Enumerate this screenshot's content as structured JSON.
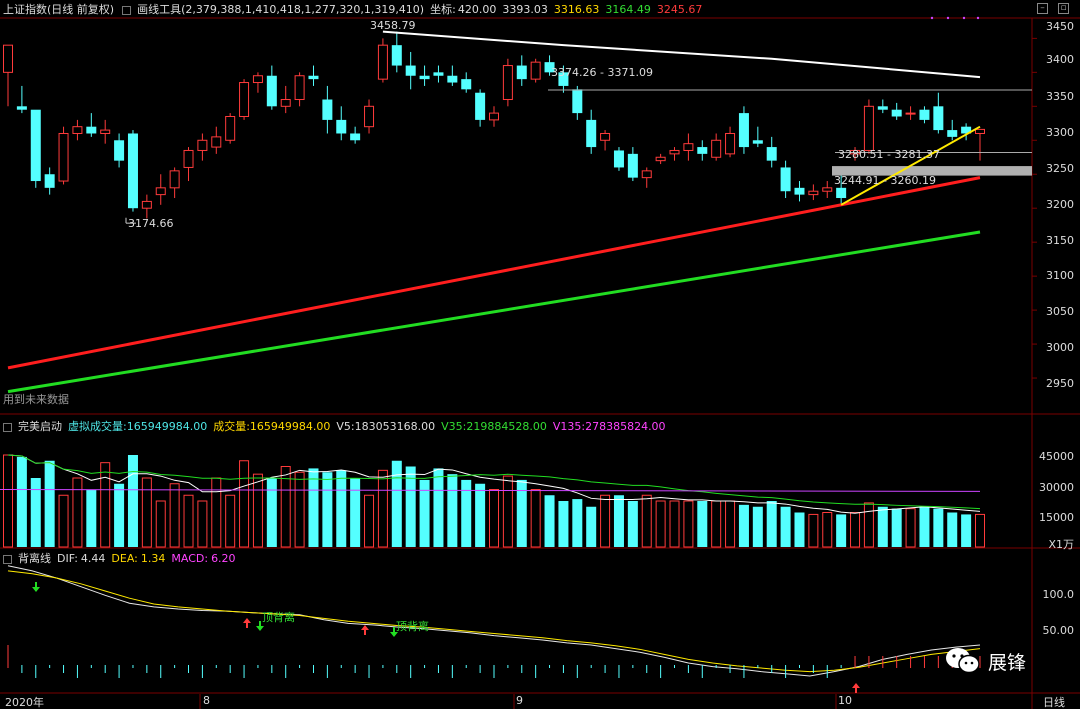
{
  "header": {
    "index_name": "上证指数(日线 前复权)",
    "tool_label": "画线工具",
    "tool_values": "(2,379,388,1,410,418,1,277,320,1,319,410)",
    "coord_label": "坐标:",
    "coord_value": "420.00",
    "open": "3393.03",
    "high": "3316.63",
    "low": "3164.49",
    "close": "3245.67"
  },
  "price_axis": [
    "3450",
    "3400",
    "3350",
    "3300",
    "3250",
    "3200",
    "3150",
    "3100",
    "3050",
    "3000",
    "2950"
  ],
  "annotations": {
    "low_point": "3174.66",
    "high_point": "3458.79",
    "range1": "3374.26 - 3371.09",
    "range2": "3280.51 - 3281.37",
    "range3": "3244.91 - 3260.19",
    "future_label": "用到未来数据"
  },
  "volume_panel": {
    "name": "完美启动",
    "virtual_label": "虚拟成交量:",
    "virtual_value": "165949984.00",
    "vol_label": "成交量:",
    "vol_value": "165949984.00",
    "v5_label": "V5:",
    "v5_value": "183053168.00",
    "v35_label": "V35:",
    "v35_value": "219884528.00",
    "v135_label": "V135:",
    "v135_value": "278385824.00",
    "axis": [
      "45000",
      "30000",
      "15000"
    ],
    "unit": "X1万"
  },
  "macd_panel": {
    "name": "背离线",
    "dif_label": "DIF:",
    "dif_value": "4.44",
    "dea_label": "DEA:",
    "dea_value": "1.34",
    "macd_label": "MACD:",
    "macd_value": "6.20",
    "axis": [
      "100.0",
      "50.00"
    ],
    "signal1": "顶背离",
    "signal2": "顶背离"
  },
  "time_axis": {
    "year": "2020年",
    "m8": "8",
    "m9": "9",
    "m10": "10",
    "period": "日线"
  },
  "watermark": {
    "text": "展锋"
  },
  "chart_data": [
    {
      "type": "candlestick",
      "title": "上证指数(日线 前复权)",
      "ylim": [
        2900,
        3480
      ],
      "candles": [
        [
          3400,
          3440,
          3350,
          3440
        ],
        [
          3350,
          3380,
          3340,
          3345
        ],
        [
          3345,
          3330,
          3230,
          3240
        ],
        [
          3250,
          3260,
          3220,
          3230
        ],
        [
          3240,
          3320,
          3235,
          3310
        ],
        [
          3310,
          3330,
          3300,
          3320
        ],
        [
          3320,
          3340,
          3305,
          3310
        ],
        [
          3310,
          3330,
          3295,
          3315
        ],
        [
          3300,
          3310,
          3260,
          3270
        ],
        [
          3310,
          3315,
          3195,
          3200
        ],
        [
          3200,
          3220,
          3185,
          3210
        ],
        [
          3220,
          3250,
          3205,
          3230
        ],
        [
          3230,
          3260,
          3215,
          3255
        ],
        [
          3260,
          3290,
          3240,
          3285
        ],
        [
          3285,
          3310,
          3270,
          3300
        ],
        [
          3290,
          3320,
          3280,
          3305
        ],
        [
          3300,
          3340,
          3295,
          3335
        ],
        [
          3335,
          3390,
          3330,
          3385
        ],
        [
          3385,
          3400,
          3370,
          3395
        ],
        [
          3395,
          3410,
          3345,
          3350
        ],
        [
          3350,
          3380,
          3340,
          3360
        ],
        [
          3360,
          3400,
          3350,
          3395
        ],
        [
          3395,
          3410,
          3380,
          3390
        ],
        [
          3360,
          3380,
          3310,
          3330
        ],
        [
          3330,
          3350,
          3300,
          3310
        ],
        [
          3310,
          3320,
          3295,
          3300
        ],
        [
          3320,
          3360,
          3310,
          3350
        ],
        [
          3390,
          3450,
          3385,
          3440
        ],
        [
          3440,
          3460,
          3400,
          3410
        ],
        [
          3410,
          3430,
          3375,
          3395
        ],
        [
          3395,
          3410,
          3380,
          3390
        ],
        [
          3400,
          3410,
          3385,
          3395
        ],
        [
          3395,
          3410,
          3380,
          3385
        ],
        [
          3390,
          3400,
          3370,
          3375
        ],
        [
          3370,
          3375,
          3320,
          3330
        ],
        [
          3330,
          3350,
          3320,
          3340
        ],
        [
          3360,
          3420,
          3350,
          3410
        ],
        [
          3410,
          3425,
          3380,
          3390
        ],
        [
          3390,
          3420,
          3385,
          3415
        ],
        [
          3415,
          3425,
          3395,
          3400
        ],
        [
          3400,
          3410,
          3370,
          3380
        ],
        [
          3375,
          3380,
          3330,
          3340
        ],
        [
          3330,
          3345,
          3280,
          3290
        ],
        [
          3300,
          3315,
          3285,
          3310
        ],
        [
          3285,
          3290,
          3255,
          3260
        ],
        [
          3280,
          3290,
          3240,
          3245
        ],
        [
          3245,
          3260,
          3230,
          3255
        ],
        [
          3270,
          3280,
          3265,
          3275
        ],
        [
          3280,
          3290,
          3270,
          3285
        ],
        [
          3285,
          3310,
          3270,
          3295
        ],
        [
          3290,
          3300,
          3270,
          3280
        ],
        [
          3275,
          3310,
          3270,
          3300
        ],
        [
          3280,
          3320,
          3275,
          3310
        ],
        [
          3340,
          3350,
          3280,
          3290
        ],
        [
          3300,
          3320,
          3290,
          3295
        ],
        [
          3290,
          3305,
          3260,
          3270
        ],
        [
          3260,
          3270,
          3215,
          3225
        ],
        [
          3230,
          3240,
          3210,
          3220
        ],
        [
          3220,
          3235,
          3212,
          3225
        ],
        [
          3225,
          3240,
          3215,
          3230
        ],
        [
          3230,
          3250,
          3205,
          3215
        ],
        [
          3280,
          3290,
          3270,
          3285
        ],
        [
          3285,
          3360,
          3280,
          3350
        ],
        [
          3350,
          3360,
          3340,
          3345
        ],
        [
          3345,
          3355,
          3330,
          3335
        ],
        [
          3340,
          3350,
          3330,
          3340
        ],
        [
          3345,
          3350,
          3325,
          3330
        ],
        [
          3350,
          3370,
          3310,
          3315
        ],
        [
          3315,
          3330,
          3300,
          3305
        ],
        [
          3320,
          3325,
          3300,
          3310
        ],
        [
          3310,
          3315,
          3270,
          3316
        ]
      ],
      "lines": {
        "red_trend": [
          [
            0,
            2965
          ],
          [
            70,
            3245
          ]
        ],
        "green_trend": [
          [
            0,
            2930
          ],
          [
            70,
            3165
          ]
        ],
        "white_ma": [
          [
            27,
            3460
          ],
          [
            40,
            3440
          ],
          [
            55,
            3420
          ],
          [
            70,
            3393
          ]
        ]
      }
    },
    {
      "type": "bar",
      "title": "完美启动",
      "ylim": [
        0,
        60000
      ],
      "values": [
        48000,
        47000,
        36000,
        45000,
        27000,
        36000,
        30000,
        44000,
        33000,
        48000,
        36000,
        24000,
        33000,
        27000,
        24000,
        36000,
        27000,
        45000,
        38000,
        36000,
        42000,
        39000,
        41000,
        39000,
        40000,
        36000,
        27000,
        40000,
        45000,
        42000,
        35000,
        41000,
        38000,
        35000,
        33000,
        30000,
        37000,
        35000,
        30000,
        27000,
        24000,
        25000,
        21000,
        27000,
        27000,
        24000,
        27000,
        24000,
        24000,
        24000,
        24000,
        24000,
        24000,
        22000,
        21000,
        24000,
        21000,
        18000,
        17000,
        18000,
        17000,
        18000,
        23000,
        21000,
        20000,
        20000,
        21000,
        20000,
        18000,
        17000,
        17000
      ]
    },
    {
      "type": "line",
      "title": "背离线",
      "series": [
        {
          "name": "DIF",
          "values": [
            135,
            128,
            118,
            106,
            94,
            83,
            78,
            75,
            73,
            72,
            70,
            68,
            67,
            60,
            55,
            53,
            50,
            48,
            45,
            42,
            38,
            35,
            32,
            28,
            25,
            20,
            15,
            8,
            0,
            -5,
            -8,
            -12,
            -15,
            -18,
            -12,
            -5,
            5,
            12,
            18,
            22,
            25
          ]
        },
        {
          "name": "DEA",
          "values": [
            128,
            124,
            118,
            110,
            100,
            90,
            82,
            78,
            75,
            72,
            70,
            68,
            66,
            62,
            58,
            55,
            52,
            50,
            47,
            44,
            41,
            38,
            35,
            31,
            28,
            24,
            19,
            12,
            5,
            0,
            -4,
            -7,
            -10,
            -12,
            -10,
            -6,
            0,
            6,
            12,
            16,
            20
          ]
        }
      ],
      "histogram": [
        6,
        5,
        4,
        3,
        2,
        2,
        2,
        3,
        3,
        3,
        3,
        3,
        3,
        3,
        3,
        3,
        3,
        3,
        3,
        3,
        3,
        3,
        3,
        3,
        3,
        3,
        3,
        3,
        3,
        3,
        3,
        3,
        3,
        3,
        3,
        3,
        3,
        3,
        3,
        3
      ]
    }
  ]
}
